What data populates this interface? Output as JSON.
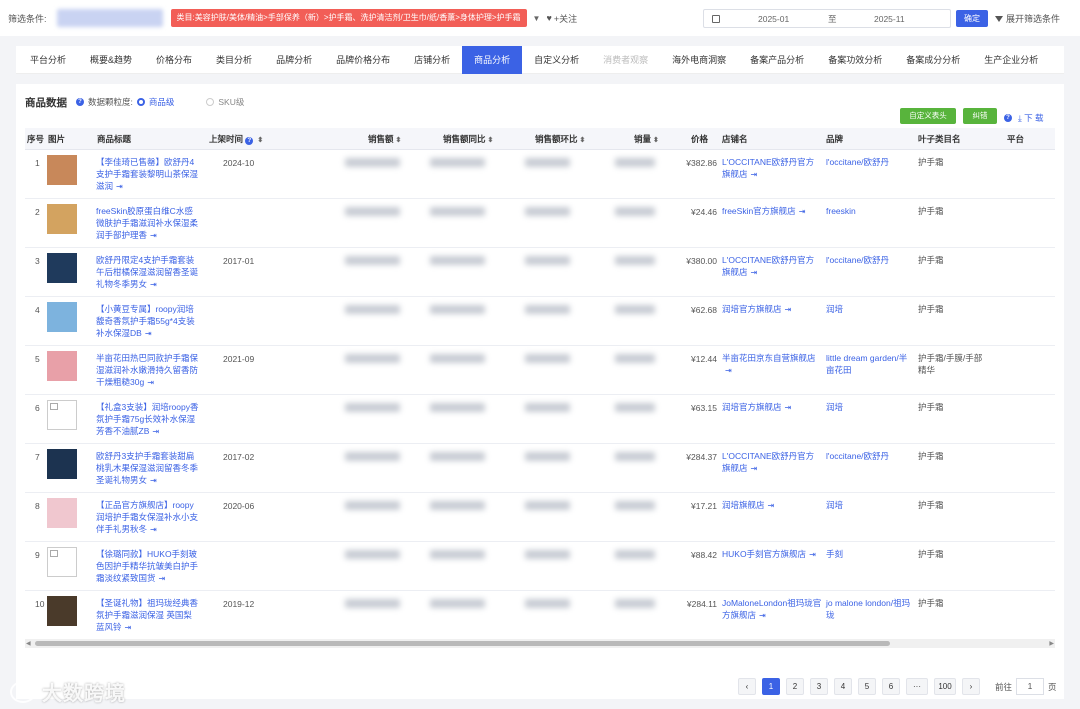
{
  "filter": {
    "label": "筛选条件:",
    "category": "类目:美容护肤/美体/精油>手部保养（新）>护手霜、洗护清洁剂/卫生巾/纸/香薰>身体护理>护手霜",
    "follow": "+关注",
    "date_start": "2025-01",
    "date_sep": "至",
    "date_end": "2025-11",
    "confirm": "确定",
    "expand": "展开筛选条件"
  },
  "tabs": [
    {
      "label": "平台分析"
    },
    {
      "label": "概要&趋势"
    },
    {
      "label": "价格分布"
    },
    {
      "label": "类目分析"
    },
    {
      "label": "品牌分析"
    },
    {
      "label": "品牌价格分布"
    },
    {
      "label": "店铺分析"
    },
    {
      "label": "商品分析"
    },
    {
      "label": "自定义分析"
    },
    {
      "label": "消费者观察"
    },
    {
      "label": "海外电商洞察"
    },
    {
      "label": "备案产品分析"
    },
    {
      "label": "备案功效分析"
    },
    {
      "label": "备案成分分析"
    },
    {
      "label": "生产企业分析"
    }
  ],
  "panel": {
    "title": "商品数据",
    "granularity_label": "数据颗粒度:",
    "opt_product": "商品级",
    "opt_sku": "SKU级",
    "custom_header": "自定义表头",
    "correct": "纠错",
    "download": "下 载"
  },
  "columns": {
    "idx": "序号",
    "img": "图片",
    "title": "商品标题",
    "date": "上架时间",
    "sales": "销售额",
    "yoy": "销售额同比",
    "mom": "销售额环比",
    "qty": "销量",
    "price": "价格",
    "shop": "店铺名",
    "brand": "品牌",
    "leaf": "叶子类目名",
    "platform": "平台"
  },
  "rows": [
    {
      "idx": "1",
      "title": "【李佳琦已售罄】欧舒丹4支护手霜套装黎明山茶保湿滋润",
      "date": "2024-10",
      "price": "¥382.86",
      "shop": "L'OCCITANE欧舒丹官方旗舰店",
      "brand": "l'occitane/欧舒丹",
      "leaf": "护手霜",
      "img": "#c8885a"
    },
    {
      "idx": "2",
      "title": "freeSkin胶原蛋白维C水感微肤护手霜滋润补水保湿柔润手部护理香",
      "date": "",
      "price": "¥24.46",
      "shop": "freeSkin官方旗舰店",
      "brand": "freeskin",
      "leaf": "护手霜",
      "img": "#d3a360"
    },
    {
      "idx": "3",
      "title": "欧舒丹限定4支护手霜套装午后柑橘保湿滋润留香圣诞礼物冬季男女",
      "date": "2017-01",
      "price": "¥380.00",
      "shop": "L'OCCITANE欧舒丹官方旗舰店",
      "brand": "l'occitane/欧舒丹",
      "leaf": "护手霜",
      "img": "#1f3a5c"
    },
    {
      "idx": "4",
      "title": "【小黄豆专属】roopy润培馥奇香氛护手霜55g*4支装补水保湿DB",
      "date": "",
      "price": "¥62.68",
      "shop": "润培官方旗舰店",
      "brand": "润培",
      "leaf": "护手霜",
      "img": "#7db3de"
    },
    {
      "idx": "5",
      "title": "半亩花田热巴同款护手霜保湿滋润补水嫩滑持久留香防干燥粗糙30g",
      "date": "2021-09",
      "price": "¥12.44",
      "shop": "半亩花田京东自营旗舰店",
      "brand": "little dream garden/半亩花田",
      "leaf": "护手霜/手膜/手部精华",
      "img": "#e8a0a8"
    },
    {
      "idx": "6",
      "title": "【礼盒3支装】润培roopy香氛护手霜75g长效补水保湿芳香不油腻ZB",
      "date": "",
      "price": "¥63.15",
      "shop": "润培官方旗舰店",
      "brand": "润培",
      "leaf": "护手霜",
      "img": ""
    },
    {
      "idx": "7",
      "title": "欧舒丹3支护手霜套装甜扁桃乳木果保湿滋润留香冬季圣诞礼物男女",
      "date": "2017-02",
      "price": "¥284.37",
      "shop": "L'OCCITANE欧舒丹官方旗舰店",
      "brand": "l'occitane/欧舒丹",
      "leaf": "护手霜",
      "img": "#1c3350"
    },
    {
      "idx": "8",
      "title": "【正品官方旗舰店】roopy润培护手霜女保湿补水小支伴手礼男秋冬",
      "date": "2020-06",
      "price": "¥17.21",
      "shop": "润培旗舰店",
      "brand": "润培",
      "leaf": "护手霜",
      "img": "#f0c7cf"
    },
    {
      "idx": "9",
      "title": "【徐璐同款】HUKO手刻玻色因护手精华抗皱美白护手霜淡纹紧致国货",
      "date": "",
      "price": "¥88.42",
      "shop": "HUKO手刻官方旗舰店",
      "brand": "手刻",
      "leaf": "护手霜",
      "img": ""
    },
    {
      "idx": "10",
      "title": "【圣诞礼物】祖玛珑经典香氛护手霜滋润保湿 英国梨 蓝风铃",
      "date": "2019-12",
      "price": "¥284.11",
      "shop": "JoMaloneLondon祖玛珑官方旗舰店",
      "brand": "jo malone london/祖玛珑",
      "leaf": "护手霜",
      "img": "#4a3a2a"
    }
  ],
  "pager": {
    "prev": "‹",
    "next": "›",
    "pages": [
      "1",
      "2",
      "3",
      "4",
      "5",
      "6",
      "···",
      "100"
    ],
    "goto_label": "前往",
    "goto_value": "1",
    "goto_suffix": "页"
  },
  "watermark": "大数跨境",
  "colors": {
    "accent": "#3b62e5",
    "category_tag": "#f25e57",
    "green": "#58b43c"
  }
}
